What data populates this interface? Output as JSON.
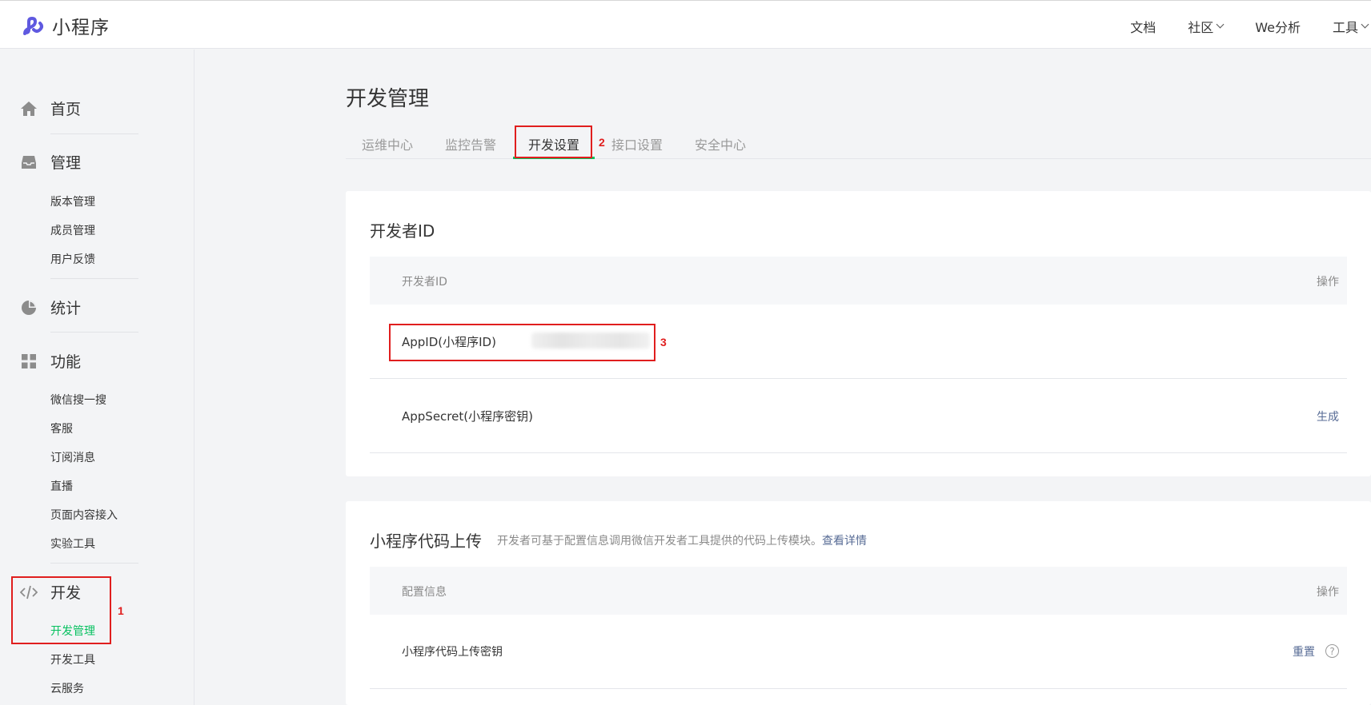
{
  "app": {
    "title": "小程序"
  },
  "topnav": [
    {
      "label": "文档",
      "has_dropdown": false
    },
    {
      "label": "社区",
      "has_dropdown": true
    },
    {
      "label": "We分析",
      "has_dropdown": false
    },
    {
      "label": "工具",
      "has_dropdown": true
    }
  ],
  "sidebar": {
    "home": {
      "label": "首页",
      "icon": "home-icon"
    },
    "manage": {
      "label": "管理",
      "icon": "inbox-icon",
      "items": [
        "版本管理",
        "成员管理",
        "用户反馈"
      ]
    },
    "stats": {
      "label": "统计",
      "icon": "pie-chart-icon"
    },
    "features": {
      "label": "功能",
      "icon": "grid-icon",
      "items": [
        "微信搜一搜",
        "客服",
        "订阅消息",
        "直播",
        "页面内容接入",
        "实验工具"
      ]
    },
    "dev": {
      "label": "开发",
      "icon": "code-icon",
      "items": [
        "开发管理",
        "开发工具",
        "云服务"
      ],
      "active": "开发管理"
    }
  },
  "main": {
    "title": "开发管理",
    "tabs": [
      "运维中心",
      "监控告警",
      "开发设置",
      "接口设置",
      "安全中心"
    ],
    "active_tab": "开发设置"
  },
  "dev_id_card": {
    "title": "开发者ID",
    "head_col1": "开发者ID",
    "head_col2": "操作",
    "rows": [
      {
        "label": "AppID(小程序ID)",
        "value_hidden": true,
        "op": ""
      },
      {
        "label": "AppSecret(小程序密钥)",
        "op": "生成"
      }
    ]
  },
  "upload_card": {
    "title": "小程序代码上传",
    "desc": "开发者可基于配置信息调用微信开发者工具提供的代码上传模块。",
    "desc_link": "查看详情",
    "head_col1": "配置信息",
    "head_col2": "操作",
    "rows": [
      {
        "label": "小程序代码上传密钥",
        "op": "重置",
        "help": "?"
      }
    ]
  },
  "annotations": [
    "1",
    "2",
    "3"
  ],
  "colors": {
    "accent_green": "#07c160",
    "link_blue": "#576b95",
    "annotation_red": "#e01e1e",
    "logo_purple": "#5f59e0"
  }
}
